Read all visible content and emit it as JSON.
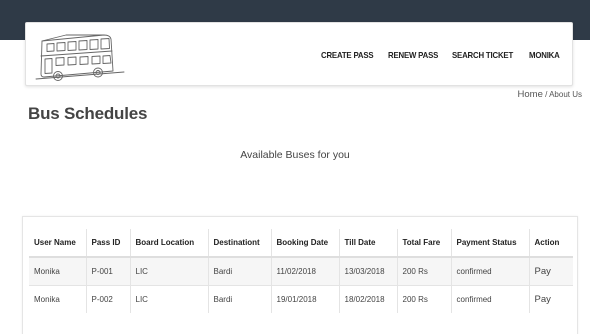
{
  "nav": {
    "create_pass": "CREATE PASS",
    "renew_pass": "RENEW PASS",
    "search_ticket": "SEARCH TICKET",
    "user": "MONIKA"
  },
  "breadcrumb": {
    "home": "Home",
    "separator": " / ",
    "current": "About Us"
  },
  "page_title": "Bus Schedules",
  "subtitle": "Available Buses for you",
  "table": {
    "headers": [
      "User Name",
      "Pass ID",
      "Board Location",
      "Destinationt",
      "Booking Date",
      "Till Date",
      "Total Fare",
      "Payment Status",
      "Action"
    ],
    "rows": [
      [
        "Monika",
        "P-001",
        "LIC",
        "Bardi",
        "11/02/2018",
        "13/03/2018",
        "200 Rs",
        "confirmed",
        "Pay"
      ],
      [
        "Monika",
        "P-002",
        "LIC",
        "Bardi",
        "19/01/2018",
        "18/02/2018",
        "200 Rs",
        "confirmed",
        "Pay"
      ]
    ]
  },
  "colors": {
    "topbar": "#2f3a47",
    "logo": "bus-line-drawing"
  }
}
